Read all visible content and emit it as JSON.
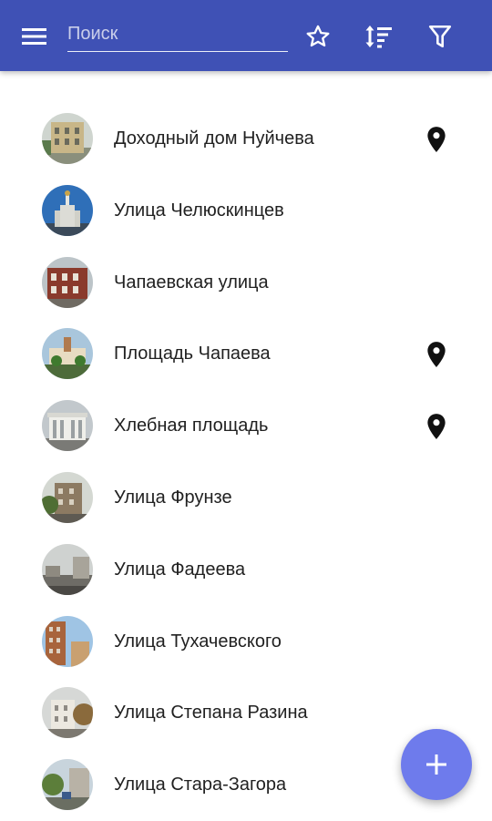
{
  "toolbar": {
    "search_placeholder": "Поиск",
    "menu_icon": "menu-icon",
    "favorite_icon": "star-outline-icon",
    "sort_icon": "sort-icon",
    "filter_icon": "filter-icon",
    "background_color": "#3f51b5"
  },
  "items": [
    {
      "title": "Доходный дом Нуйчева",
      "has_location": true
    },
    {
      "title": "Улица Челюскинцев",
      "has_location": false
    },
    {
      "title": "Чапаевская улица",
      "has_location": false
    },
    {
      "title": "Площадь Чапаева",
      "has_location": true
    },
    {
      "title": "Хлебная площадь",
      "has_location": true
    },
    {
      "title": "Улица Фрунзе",
      "has_location": false
    },
    {
      "title": "Улица Фадеева",
      "has_location": false
    },
    {
      "title": "Улица Тухачевского",
      "has_location": false
    },
    {
      "title": "Улица Степана Разина",
      "has_location": false
    },
    {
      "title": "Улица Стара-Загора",
      "has_location": false
    }
  ],
  "fab": {
    "icon": "plus-icon",
    "color": "#6e7bec"
  }
}
